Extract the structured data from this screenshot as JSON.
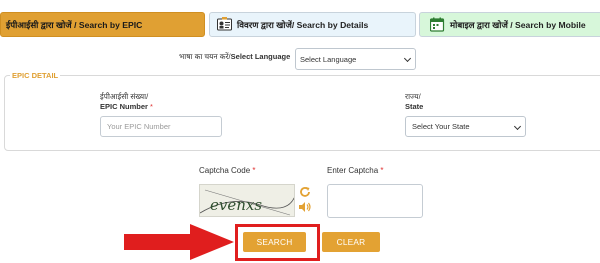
{
  "tabs": [
    {
      "label": "ईपीआईसी द्वारा खोजें / Search by EPIC",
      "active": true
    },
    {
      "label": "विवरण द्वारा खोजें/ Search by Details",
      "active": false
    },
    {
      "label": "मोबाइल द्वारा खोजें / Search by Mobile",
      "active": false
    }
  ],
  "language": {
    "label_hi": "भाषा का चयन करें/",
    "label_en": "Select Language",
    "selected": "Select Language"
  },
  "epic_detail": {
    "legend": "EPIC DETAIL",
    "epic_label_hi": "ईपीआईसी संख्या/",
    "epic_label_en": "EPIC Number",
    "epic_placeholder": "Your EPIC Number",
    "state_label_hi": "राज्य/",
    "state_label_en": "State",
    "state_selected": "Select Your State",
    "required_mark": "*"
  },
  "captcha": {
    "code_label": "Captcha Code",
    "enter_label": "Enter Captcha",
    "captcha_text": "evenxs",
    "required_mark": "*"
  },
  "buttons": {
    "search": "SEARCH",
    "clear": "CLEAR"
  },
  "colors": {
    "accent": "#e3a233",
    "highlight": "#e01e1e"
  },
  "icons": [
    "search-id-icon",
    "details-card-icon",
    "mobile-calendar-icon",
    "refresh-icon",
    "audio-speaker-icon",
    "pointer-arrow-icon"
  ]
}
